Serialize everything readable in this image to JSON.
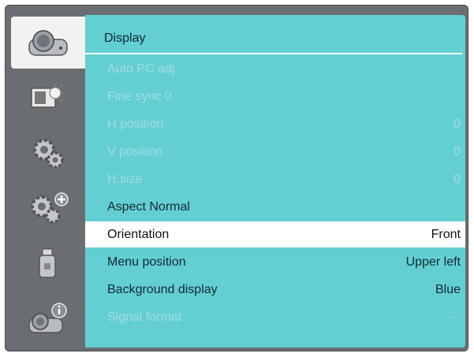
{
  "menu": {
    "title": "Display",
    "items": [
      {
        "label": "Auto PC adj.",
        "value": ""
      },
      {
        "label": "Fine sync 0",
        "value": ""
      },
      {
        "label": "H position",
        "value": "0"
      },
      {
        "label": "V position",
        "value": "0"
      },
      {
        "label": "H.size",
        "value": "0"
      },
      {
        "label": "Aspect Normal",
        "value": ""
      },
      {
        "label": "Orientation",
        "value": "Front"
      },
      {
        "label": "Menu position",
        "value": "Upper left"
      },
      {
        "label": "Background display",
        "value": "Blue"
      },
      {
        "label": "Signal format",
        "value": "···"
      }
    ]
  },
  "sidebar": {
    "icons": [
      "projector-icon",
      "picture-icon",
      "gears-icon",
      "gears-plus-icon",
      "usb-icon",
      "info-icon"
    ],
    "active": "projector-icon"
  },
  "colors": {
    "panel": "#63cfd3",
    "selected_row": "#ffffff",
    "frame": "#6a6e72",
    "disabled_text": "#a2dde0"
  }
}
